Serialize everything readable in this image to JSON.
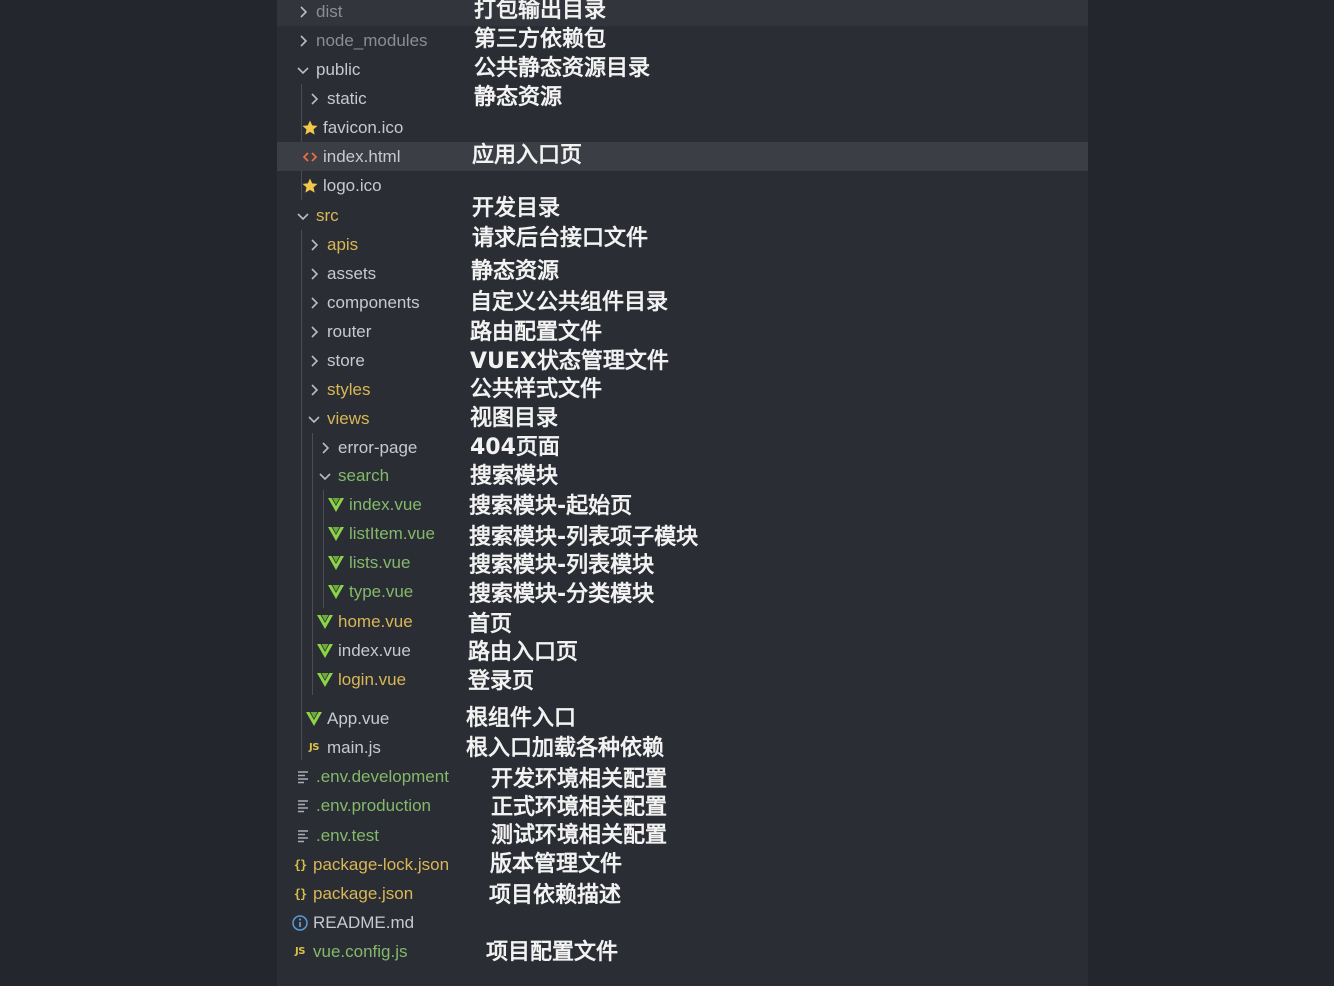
{
  "colors": {
    "background": "#23272d",
    "panel": "#2a2d33",
    "selected_row": "#3b3e45",
    "folder_text": "#c6c9cf",
    "modified_text": "#d9b656",
    "untracked_text": "#83b96a",
    "vue_icon": "#8bd448",
    "star_icon": "#f2c84b",
    "html_icon": "#e66f3d",
    "annotation_text": "#f2f2f2"
  },
  "tree": [
    {
      "name": "dist",
      "icon": "chevron-right-icon",
      "note": "打包输出目录"
    },
    {
      "name": "node_modules",
      "icon": "chevron-right-icon",
      "note": "第三方依赖包"
    },
    {
      "name": "public",
      "icon": "chevron-down-icon",
      "note": "公共静态资源目录"
    },
    {
      "name": "static",
      "icon": "chevron-right-icon",
      "note": "静态资源"
    },
    {
      "name": "favicon.ico",
      "icon": "star-icon",
      "note": ""
    },
    {
      "name": "index.html",
      "icon": "html-icon",
      "note": "应用入口页"
    },
    {
      "name": "logo.ico",
      "icon": "star-icon",
      "note": ""
    },
    {
      "name": "src",
      "icon": "chevron-down-icon",
      "note": "开发目录"
    },
    {
      "name": "apis",
      "icon": "chevron-right-icon",
      "note": "请求后台接口文件"
    },
    {
      "name": "assets",
      "icon": "chevron-right-icon",
      "note": "静态资源"
    },
    {
      "name": "components",
      "icon": "chevron-right-icon",
      "note": "自定义公共组件目录"
    },
    {
      "name": "router",
      "icon": "chevron-right-icon",
      "note": "路由配置文件"
    },
    {
      "name": "store",
      "icon": "chevron-right-icon",
      "note": "VUEX状态管理文件"
    },
    {
      "name": "styles",
      "icon": "chevron-right-icon",
      "note": "公共样式文件"
    },
    {
      "name": "views",
      "icon": "chevron-down-icon",
      "note": "视图目录"
    },
    {
      "name": "error-page",
      "icon": "chevron-right-icon",
      "note": "404页面"
    },
    {
      "name": "search",
      "icon": "chevron-down-icon",
      "note": "搜索模块"
    },
    {
      "name": "index.vue",
      "icon": "vue-icon",
      "note": "搜索模块-起始页"
    },
    {
      "name": "listItem.vue",
      "icon": "vue-icon",
      "note": "搜索模块-列表项子模块"
    },
    {
      "name": "lists.vue",
      "icon": "vue-icon",
      "note": "搜索模块-列表模块"
    },
    {
      "name": "type.vue",
      "icon": "vue-icon",
      "note": "搜索模块-分类模块"
    },
    {
      "name": "home.vue",
      "icon": "vue-icon",
      "note": "首页"
    },
    {
      "name": "index.vue",
      "icon": "vue-icon",
      "note": "路由入口页"
    },
    {
      "name": "login.vue",
      "icon": "vue-icon",
      "note": "登录页"
    },
    {
      "name": "App.vue",
      "icon": "vue-icon",
      "note": "根组件入口"
    },
    {
      "name": "main.js",
      "icon": "js-icon",
      "note": "根入口加载各种依赖"
    },
    {
      "name": ".env.development",
      "icon": "env-file-icon",
      "note": "开发环境相关配置"
    },
    {
      "name": ".env.production",
      "icon": "env-file-icon",
      "note": "正式环境相关配置"
    },
    {
      "name": ".env.test",
      "icon": "env-file-icon",
      "note": "测试环境相关配置"
    },
    {
      "name": "package-lock.json",
      "icon": "json-icon",
      "note": "版本管理文件"
    },
    {
      "name": "package.json",
      "icon": "json-icon",
      "note": "项目依赖描述"
    },
    {
      "name": "README.md",
      "icon": "info-icon",
      "note": ""
    },
    {
      "name": "vue.config.js",
      "icon": "js-icon",
      "note": "项目配置文件"
    }
  ]
}
